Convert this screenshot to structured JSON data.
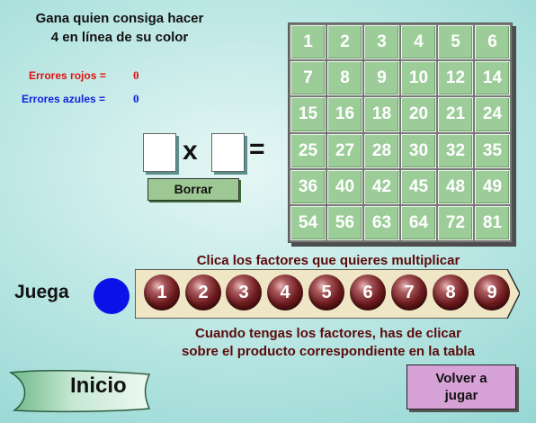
{
  "instructions": {
    "line1": "Gana quien consiga hacer",
    "line2": "4 en línea de su color"
  },
  "errors": {
    "red_label": "Errores rojos =",
    "red_value": "0",
    "blue_label": "Errores azules =",
    "blue_value": "0",
    "red_color": "#e01010",
    "blue_color": "#1020e0"
  },
  "equation": {
    "times": "x",
    "equals": "="
  },
  "borrar_label": "Borrar",
  "board": [
    [
      "1",
      "2",
      "3",
      "4",
      "5",
      "6"
    ],
    [
      "7",
      "8",
      "9",
      "10",
      "12",
      "14"
    ],
    [
      "15",
      "16",
      "18",
      "20",
      "21",
      "24"
    ],
    [
      "25",
      "27",
      "28",
      "30",
      "32",
      "35"
    ],
    [
      "36",
      "40",
      "42",
      "45",
      "48",
      "49"
    ],
    [
      "54",
      "56",
      "63",
      "64",
      "72",
      "81"
    ]
  ],
  "factor_prompt": "Clica los factores que quieres multiplicar",
  "turn": {
    "label": "Juega",
    "player_color": "#0a12e8"
  },
  "factors": [
    "1",
    "2",
    "3",
    "4",
    "5",
    "6",
    "7",
    "8",
    "9"
  ],
  "hint": {
    "line1": "Cuando tengas los factores, has de clicar",
    "line2": "sobre el producto correspondiente en la tabla"
  },
  "inicio_label": "Inicio",
  "volver": {
    "line1": "Volver a",
    "line2": "jugar"
  }
}
